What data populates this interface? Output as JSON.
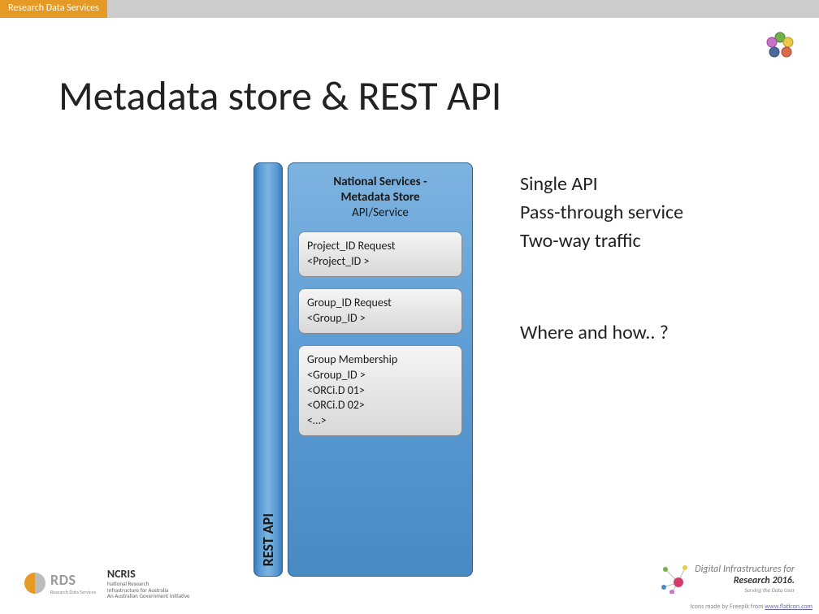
{
  "header": {
    "tab": "Research Data Services"
  },
  "title": "Metadata store & REST API",
  "diagram": {
    "rest_label": "REST API",
    "store_header": {
      "l1": "National Services -",
      "l2": "Metadata Store",
      "l3": "API/Service"
    },
    "boxes": [
      {
        "lines": [
          "Project_ID Request",
          "<Project_ID >"
        ]
      },
      {
        "lines": [
          "Group_ID Request",
          "<Group_ID >"
        ]
      },
      {
        "lines": [
          "Group Membership",
          "<Group_ID >",
          "<ORCi.D 01>",
          "<ORCi.D 02>",
          "<…>"
        ]
      }
    ]
  },
  "side_text": {
    "block1": [
      "Single API",
      "Pass-through service",
      "Two-way traffic"
    ],
    "block2": "Where and how.. ?"
  },
  "footer": {
    "rds": {
      "text": "RDS",
      "sub": "Research Data Services"
    },
    "ncris": {
      "text": "NCRIS",
      "sub1": "National Research",
      "sub2": "Infrastructure for Australia",
      "sub3": "An Australian Government Initiative"
    },
    "dir": {
      "l1": "Digital Infrastructures for",
      "l2": "Research 2016.",
      "l3": "Serving the Data User"
    },
    "credit_prefix": "Icons made by Freepik from ",
    "credit_link": "www.flaticon.com"
  }
}
